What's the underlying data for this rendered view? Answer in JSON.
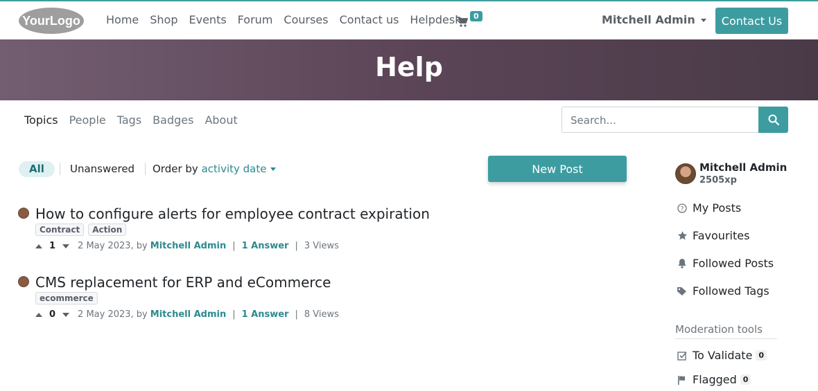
{
  "header": {
    "logo_text": "YourLogo",
    "nav": [
      "Home",
      "Shop",
      "Events",
      "Forum",
      "Courses",
      "Contact us",
      "Helpdesk"
    ],
    "cart_count": "0",
    "user_name": "Mitchell Admin",
    "contact_button": "Contact Us"
  },
  "banner": {
    "title": "Help"
  },
  "subnav": {
    "items": [
      "Topics",
      "People",
      "Tags",
      "Badges",
      "About"
    ],
    "active": "Topics",
    "search_placeholder": "Search..."
  },
  "filters": {
    "all": "All",
    "unanswered": "Unanswered",
    "order_label": "Order by",
    "order_value": "activity date",
    "new_post": "New Post"
  },
  "posts": [
    {
      "title": "How to configure alerts for employee contract expiration",
      "tags": [
        "Contract",
        "Action"
      ],
      "votes": "1",
      "date_by": "2 May 2023, by",
      "author": "Mitchell Admin",
      "answers": "1 Answer",
      "views": "3 Views"
    },
    {
      "title": "CMS replacement for ERP and eCommerce",
      "tags": [
        "ecommerce"
      ],
      "votes": "0",
      "date_by": "2 May 2023, by",
      "author": "Mitchell Admin",
      "answers": "1 Answer",
      "views": "8 Views"
    }
  ],
  "sidebar": {
    "user_name": "Mitchell Admin",
    "xp": "2505xp",
    "links": [
      {
        "label": "My Posts",
        "icon": "question-circle-icon"
      },
      {
        "label": "Favourites",
        "icon": "star-icon"
      },
      {
        "label": "Followed Posts",
        "icon": "bell-icon"
      },
      {
        "label": "Followed Tags",
        "icon": "tags-icon"
      }
    ],
    "moderation_title": "Moderation tools",
    "moderation": [
      {
        "label": "To Validate",
        "count": "0",
        "icon": "check-square-icon"
      },
      {
        "label": "Flagged",
        "count": "0",
        "icon": "flag-icon"
      }
    ]
  },
  "colors": {
    "accent": "#3d9ca0",
    "banner": "#5b4557",
    "link": "#2c8a8e"
  }
}
